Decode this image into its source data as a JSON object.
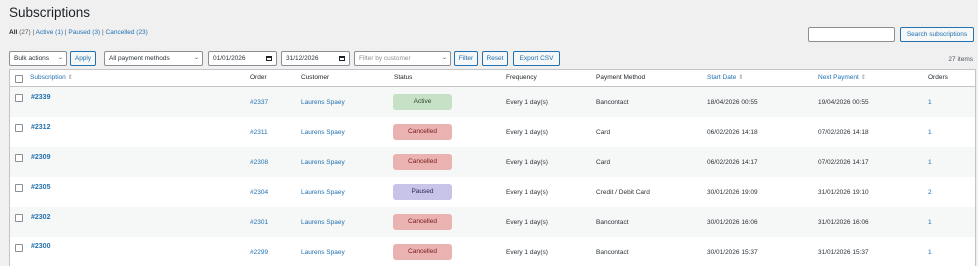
{
  "page_title": "Subscriptions",
  "filters": {
    "all_label": "All",
    "all_count": "(27)",
    "sep1": " | ",
    "active_label": "Active",
    "active_count": "(1)",
    "sep2": " | ",
    "paused_label": "Paused",
    "paused_count": "(3)",
    "sep3": " | ",
    "cancelled_label": "Cancelled",
    "cancelled_count": "(23)"
  },
  "search": {
    "value": "",
    "button_label": "Search subscriptions"
  },
  "toolbar": {
    "bulk_actions": "Bulk actions",
    "apply_label": "Apply",
    "payment_methods": "All payment methods",
    "date_from": "01/01/2026",
    "date_to": "31/12/2026",
    "customer_placeholder": "Filter by customer",
    "filter_label": "Filter",
    "reset_label": "Reset",
    "export_label": "Export CSV",
    "items_count": "27 items"
  },
  "columns": {
    "subscription": "Subscription",
    "order": "Order",
    "customer": "Customer",
    "status": "Status",
    "frequency": "Frequency",
    "payment_method": "Payment Method",
    "start_date": "Start Date",
    "next_payment": "Next Payment",
    "orders": "Orders"
  },
  "rows": [
    {
      "id": "#2339",
      "order": "#2337",
      "customer": "Laurens Spaey",
      "status": "Active",
      "frequency": "Every 1 day(s)",
      "payment": "Bancontact",
      "start": "18/04/2026 00:55",
      "next": "19/04/2026 00:55",
      "orders": "1"
    },
    {
      "id": "#2312",
      "order": "#2311",
      "customer": "Laurens Spaey",
      "status": "Cancelled",
      "frequency": "Every 1 day(s)",
      "payment": "Card",
      "start": "06/02/2026 14:18",
      "next": "07/02/2026 14:18",
      "orders": "1"
    },
    {
      "id": "#2309",
      "order": "#2308",
      "customer": "Laurens Spaey",
      "status": "Cancelled",
      "frequency": "Every 1 day(s)",
      "payment": "Card",
      "start": "06/02/2026 14:17",
      "next": "07/02/2026 14:17",
      "orders": "1"
    },
    {
      "id": "#2305",
      "order": "#2304",
      "customer": "Laurens Spaey",
      "status": "Paused",
      "frequency": "Every 1 day(s)",
      "payment": "Credit / Debit Card",
      "start": "30/01/2026 19:09",
      "next": "31/01/2026 19:10",
      "orders": "2"
    },
    {
      "id": "#2302",
      "order": "#2301",
      "customer": "Laurens Spaey",
      "status": "Cancelled",
      "frequency": "Every 1 day(s)",
      "payment": "Bancontact",
      "start": "30/01/2026 16:06",
      "next": "31/01/2026 16:06",
      "orders": "1"
    },
    {
      "id": "#2300",
      "order": "#2299",
      "customer": "Laurens Spaey",
      "status": "Cancelled",
      "frequency": "Every 1 day(s)",
      "payment": "Bancontact",
      "start": "30/01/2026 15:37",
      "next": "31/01/2026 15:37",
      "orders": "1"
    }
  ],
  "colors": {
    "link": "#2271b1",
    "active_bg": "#c6e1c6",
    "cancelled_bg": "#eab2b0",
    "paused_bg": "#c8c3e8"
  }
}
